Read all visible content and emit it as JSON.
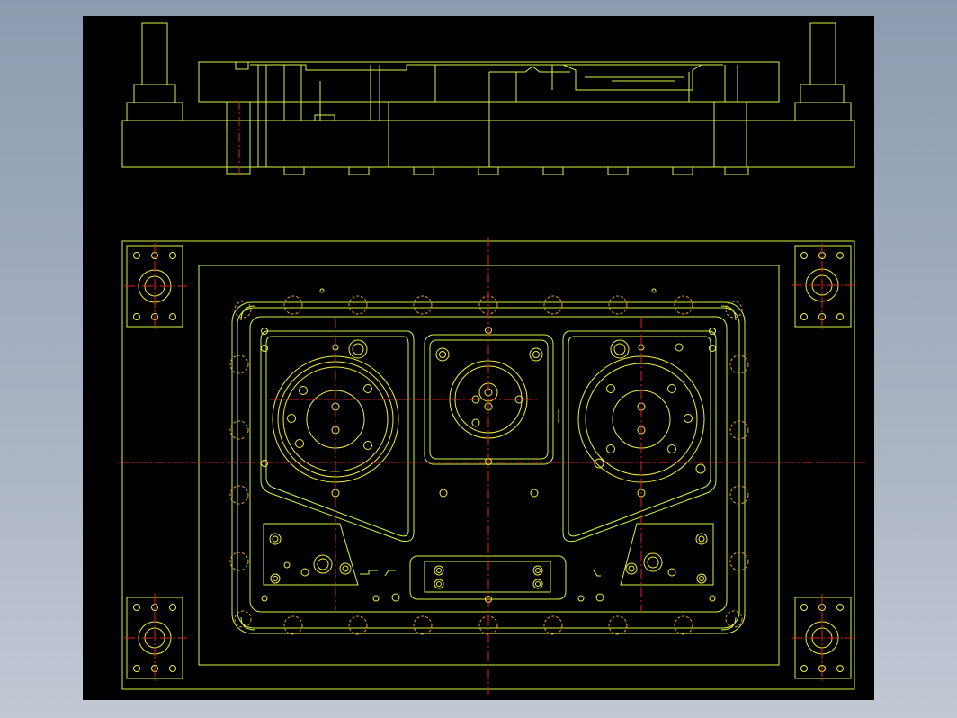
{
  "drawing": {
    "title": "",
    "views": [
      "section-elevation",
      "plan"
    ],
    "colors": {
      "background": "#000000",
      "geometry": "#d4f542",
      "circles": "#f2ee3a",
      "centerlines": "#e02020",
      "hidden_features": "#e8a020",
      "screen": "#9aa6ba"
    }
  },
  "ui": {
    "side_mark": "–"
  },
  "icons": {
    "guide_pillar": "pillar-symbol",
    "bolt_pattern": "bolt-circle-symbol",
    "centerline": "dash-dot-line"
  }
}
